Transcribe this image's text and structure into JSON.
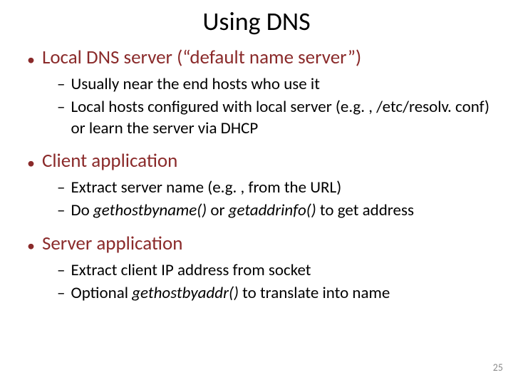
{
  "title": "Using DNS",
  "sections": [
    {
      "heading": "Local DNS server (“default name server”)",
      "items": [
        {
          "text": "Usually near the end hosts who use it"
        },
        {
          "text": "Local hosts configured with local server (e.g. , /etc/resolv. conf) or learn the server via DHCP"
        }
      ]
    },
    {
      "heading": "Client application",
      "items": [
        {
          "text": "Extract server name (e.g. , from the URL)"
        },
        {
          "prefix": "Do ",
          "em1": "gethostbyname()",
          "mid": " or ",
          "em2": "getaddrinfo()",
          "suffix": " to get address"
        }
      ]
    },
    {
      "heading": "Server application",
      "items": [
        {
          "text": "Extract client IP address from socket"
        },
        {
          "prefix": "Optional ",
          "em1": "gethostbyaddr()",
          "suffix": " to translate into name"
        }
      ]
    }
  ],
  "page_number": "25"
}
